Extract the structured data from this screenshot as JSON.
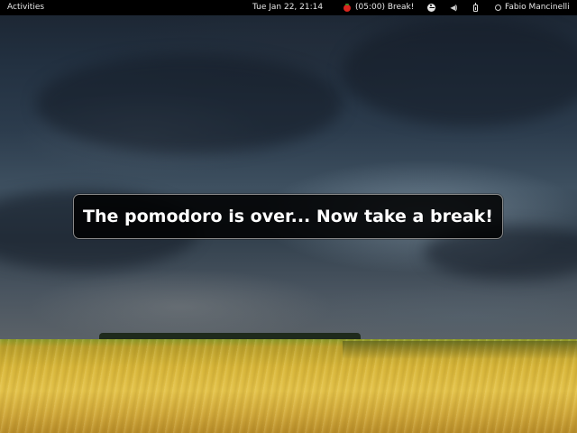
{
  "top_bar": {
    "activities_label": "Activities",
    "clock_text": "Tue Jan 22, 21:14",
    "pomodoro_text": "(05:00) Break!",
    "user_name": "Fabio Mancinelli",
    "icons": {
      "pomodoro": "tomato-icon",
      "accessibility": "accessibility-icon",
      "volume": "volume-icon",
      "battery": "battery-icon",
      "user_status": "user-status-icon"
    }
  },
  "notification": {
    "message": "The pomodoro is over... Now take a break!"
  },
  "colors": {
    "top_bar_bg": "#000000",
    "top_bar_text": "#e6e6e6",
    "banner_bg": "#000000",
    "banner_border": "#8a8a8a",
    "pomodoro_tomato": "#d8261e"
  }
}
